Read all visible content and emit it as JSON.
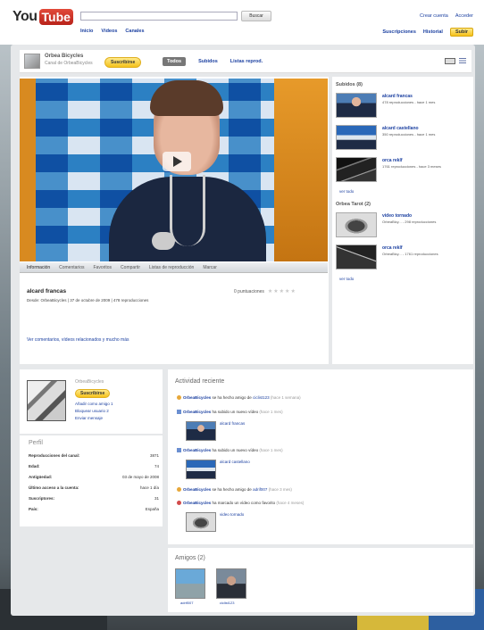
{
  "masthead": {
    "logo_you": "You",
    "logo_tube": "Tube",
    "search_button": "Buscar",
    "nav": [
      "Inicio",
      "Vídeos",
      "Canales"
    ],
    "user_links": [
      "Crear cuenta",
      "Acceder"
    ],
    "user_tools": [
      "Suscripciones",
      "Historial"
    ],
    "upload": "Subir"
  },
  "channel": {
    "name": "Orbea Bicycles",
    "subtitle": "Canal de OrbeaBicycles",
    "subscribe": "Suscribirse",
    "tabs": [
      "Todos",
      "Subidos",
      "Listas reprod."
    ]
  },
  "player": {
    "tabs": [
      "Información",
      "Comentarios",
      "Favoritos",
      "Compartir",
      "Listas de reproducción",
      "Marcar"
    ],
    "title": "alcard francas",
    "from": "Desde: OrbeaBicycles | 37 de octubre de 2009 | 478 reproducciones",
    "ratings": "0 puntuaciones",
    "stars": "★★★★★",
    "more": "Ver comentarios, vídeos relacionados y mucho más"
  },
  "sidebar": {
    "uploaded_header": "Subidos (8)",
    "uploaded": [
      {
        "title": "alcard francas",
        "meta": "478 reproducciones - hace 1 mes"
      },
      {
        "title": "alcard castellano",
        "meta": "350 reproducciones - hace 1 mes"
      },
      {
        "title": "orca reklf",
        "meta": "1761 reproducciones - hace 3 meses"
      }
    ],
    "uploaded_more": "ver todo",
    "favorites_header": "Orbea Tarot (2)",
    "favorites": [
      {
        "title": "video tornado",
        "meta": "OrbeaBicy... - 298 reproducciones"
      },
      {
        "title": "orca reklf",
        "meta": "OrbeaBicy... - 1761 reproducciones"
      }
    ],
    "favorites_more": "ver todo"
  },
  "about": {
    "name": "OrbeaBicycles",
    "subscribe": "Suscribirse",
    "links": [
      "Añadir como amigo 1",
      "Bloquear usuario 2",
      "Enviar mensaje"
    ]
  },
  "profile": {
    "header": "Perfil",
    "rows": [
      {
        "k": "Reproducciones del canal:",
        "v": "3871"
      },
      {
        "k": "Edad:",
        "v": "74"
      },
      {
        "k": "Antigüedad:",
        "v": "03 de mayo de 2008"
      },
      {
        "k": "Último acceso a la cuenta:",
        "v": "hace 1 día"
      },
      {
        "k": "Suscriptores:",
        "v": "31"
      },
      {
        "k": "País:",
        "v": "España"
      }
    ]
  },
  "activity": {
    "header": "Actividad reciente",
    "items": [
      {
        "user": "OrbeaBicycles",
        "text": " se ha hecho amigo de ",
        "target": "ciclist123",
        "time": "(hace 1 semana)"
      },
      {
        "user": "OrbeaBicycles",
        "text": " ha subido un nuevo vídeo ",
        "target": "",
        "time": "(hace 1 mes)",
        "video": "alcard francas"
      },
      {
        "user": "OrbeaBicycles",
        "text": " ha subido un nuevo vídeo ",
        "target": "",
        "time": "(hace 1 mes)",
        "video": "alcard castellano"
      },
      {
        "user": "OrbeaBicycles",
        "text": " se ha hecho amigo de ",
        "target": "adrif007",
        "time": "(hace 3 mes)"
      },
      {
        "user": "OrbeaBicycles",
        "text": " ha marcado un vídeo como favorito ",
        "target": "",
        "time": "(hace 4 meses)",
        "video": "video tornado"
      }
    ]
  },
  "friends": {
    "header": "Amigos (2)",
    "items": [
      "adrif007",
      "ciclist123"
    ]
  },
  "colors": {
    "link": "#1a3fa0",
    "subscribe_yellow": "#f5c21b",
    "youtube_red": "#c8281d"
  }
}
